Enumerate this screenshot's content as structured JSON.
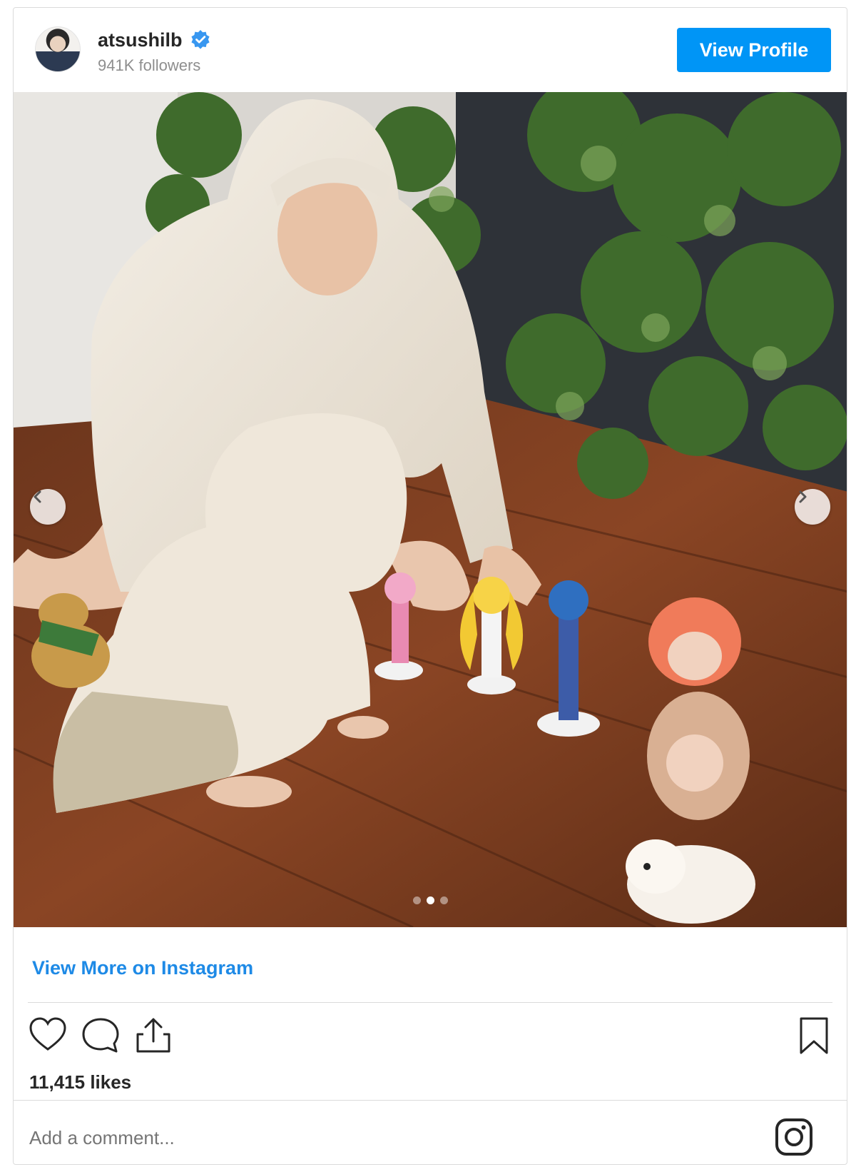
{
  "header": {
    "username": "atsushilb",
    "followers": "941K followers",
    "view_profile_label": "View Profile"
  },
  "photo": {
    "carousel_dots": 3,
    "active_dot": 2
  },
  "links": {
    "view_more": "View More on Instagram"
  },
  "stats": {
    "likes": "11,415 likes"
  },
  "comment": {
    "placeholder": "Add a comment..."
  },
  "icons": {
    "avatar": "avatar",
    "verified": "verified-badge-icon",
    "prev": "chevron-left-icon",
    "next": "chevron-right-icon",
    "like": "heart-icon",
    "comment": "comment-bubble-icon",
    "share": "share-icon",
    "save": "bookmark-icon",
    "instagram": "instagram-logo-icon"
  },
  "colors": {
    "accent": "#0095f6",
    "link": "#1e8ae6",
    "muted": "#8e8e8e"
  }
}
